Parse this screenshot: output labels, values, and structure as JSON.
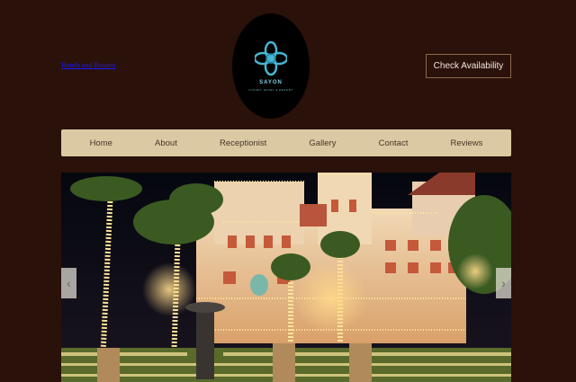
{
  "header": {
    "top_link": "Hotels and Resorts",
    "logo": {
      "name": "SAYON",
      "tagline": "LUXURY HOTEL & RESORT"
    },
    "check_availability": "Check Availability"
  },
  "nav": {
    "items": [
      "Home",
      "About",
      "Receptionist",
      "Gallery",
      "Contact",
      "Reviews"
    ]
  },
  "slider": {
    "prev_glyph": "‹",
    "next_glyph": "›"
  },
  "colors": {
    "background": "#2a1109",
    "nav_bg": "#dac9a3",
    "logo_accent": "#7fd4e6"
  }
}
